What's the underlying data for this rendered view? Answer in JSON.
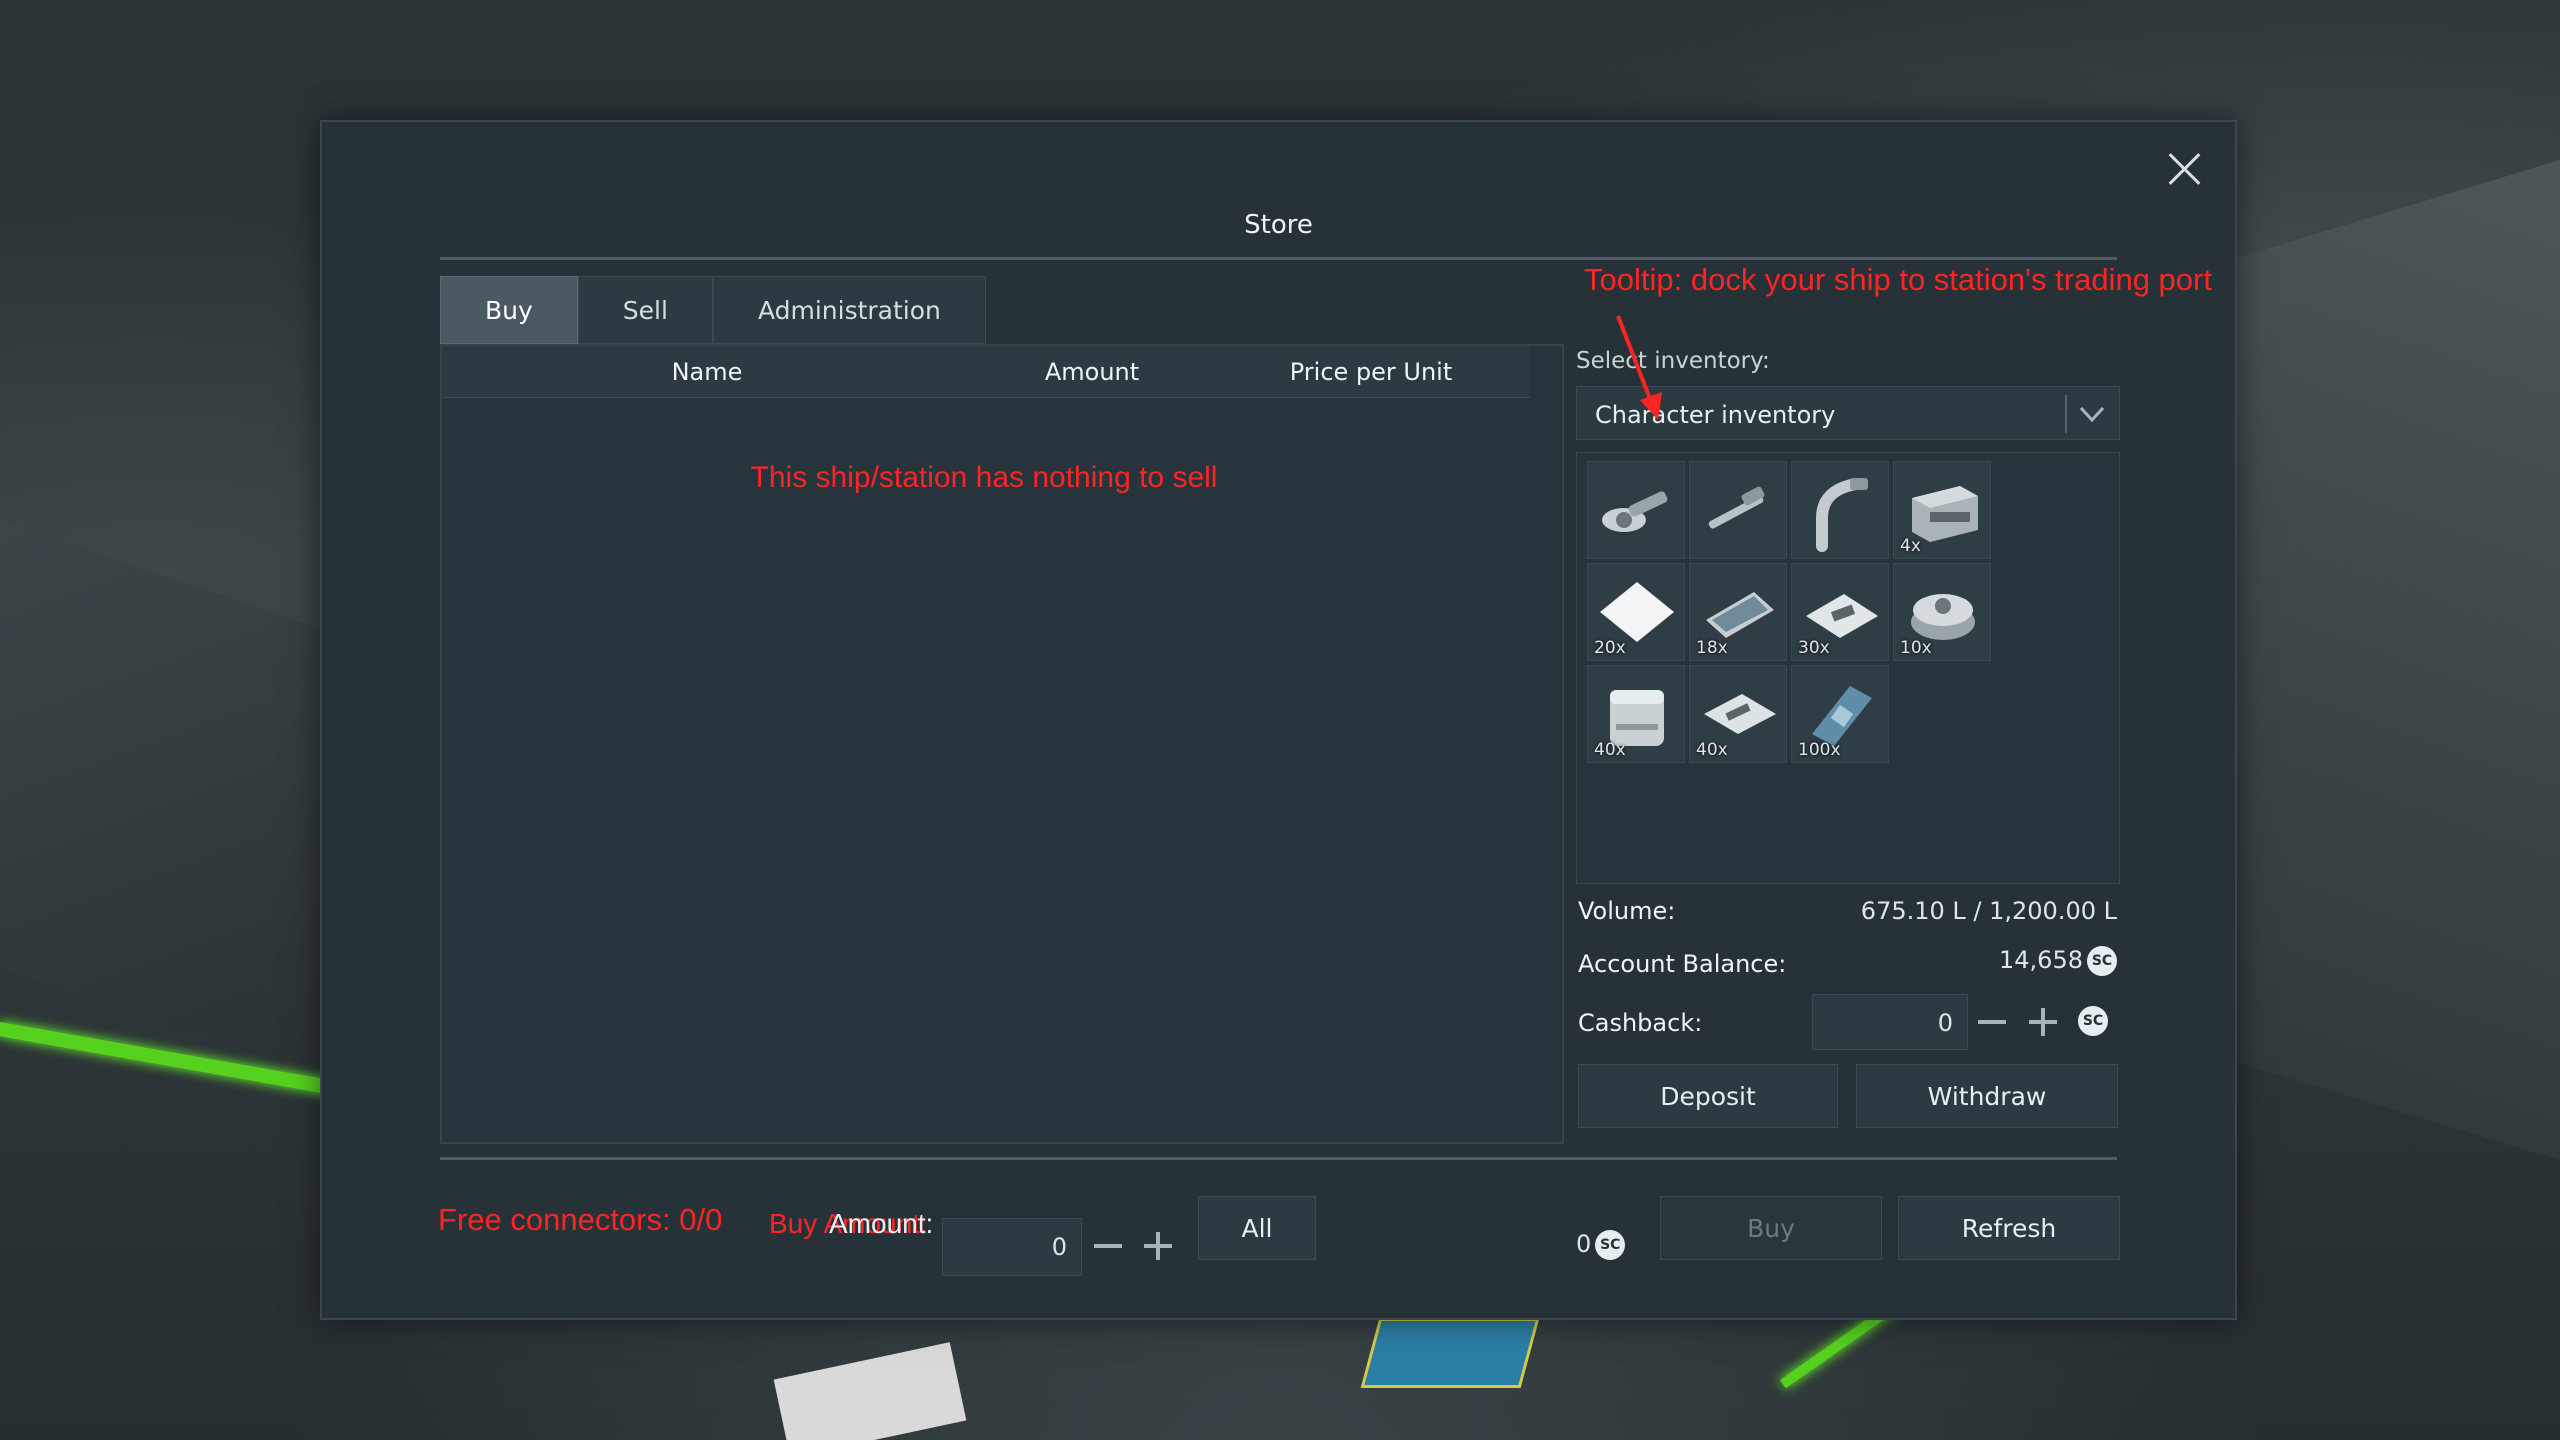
{
  "window": {
    "title": "Store"
  },
  "tabs": [
    {
      "label": "Buy",
      "active": true
    },
    {
      "label": "Sell",
      "active": false
    },
    {
      "label": "Administration",
      "active": false
    }
  ],
  "list": {
    "columns": [
      "Name",
      "Amount",
      "Price per Unit"
    ],
    "empty_message": "This ship/station has nothing to sell"
  },
  "annotations": {
    "tooltip": "Tooltip: dock your ship to station's trading port",
    "free_connectors": "Free connectors: 0/0"
  },
  "inventory": {
    "label": "Select inventory:",
    "selected": "Character inventory",
    "items": [
      {
        "icon": "angle-grinder-icon",
        "qty": ""
      },
      {
        "icon": "hand-drill-icon",
        "qty": ""
      },
      {
        "icon": "welder-icon",
        "qty": ""
      },
      {
        "icon": "steel-plate-crate-icon",
        "qty": "4x"
      },
      {
        "icon": "glass-pane-icon",
        "qty": "20x"
      },
      {
        "icon": "display-panel-icon",
        "qty": "18x"
      },
      {
        "icon": "computer-component-icon",
        "qty": "30x"
      },
      {
        "icon": "motor-icon",
        "qty": "10x"
      },
      {
        "icon": "metal-canister-icon",
        "qty": "40x"
      },
      {
        "icon": "interior-plate-icon",
        "qty": "40x"
      },
      {
        "icon": "circuit-component-icon",
        "qty": "100x"
      }
    ]
  },
  "account": {
    "volume_label": "Volume:",
    "volume_value": "675.10 L / 1,200.00 L",
    "balance_label": "Account Balance:",
    "balance_value": "14,658",
    "cashback_label": "Cashback:",
    "cashback_value": "0",
    "currency_symbol": "SC",
    "deposit_label": "Deposit",
    "withdraw_label": "Withdraw"
  },
  "bottom": {
    "amount_label_overlay": "Buy Amount:",
    "amount_label": "Amount:",
    "amount_value": "0",
    "all_label": "All",
    "total_value": "0",
    "buy_label": "Buy",
    "refresh_label": "Refresh"
  },
  "colors": {
    "panel": "#263238",
    "annotation_red": "#ff2424",
    "accent_green": "#56d21e"
  }
}
